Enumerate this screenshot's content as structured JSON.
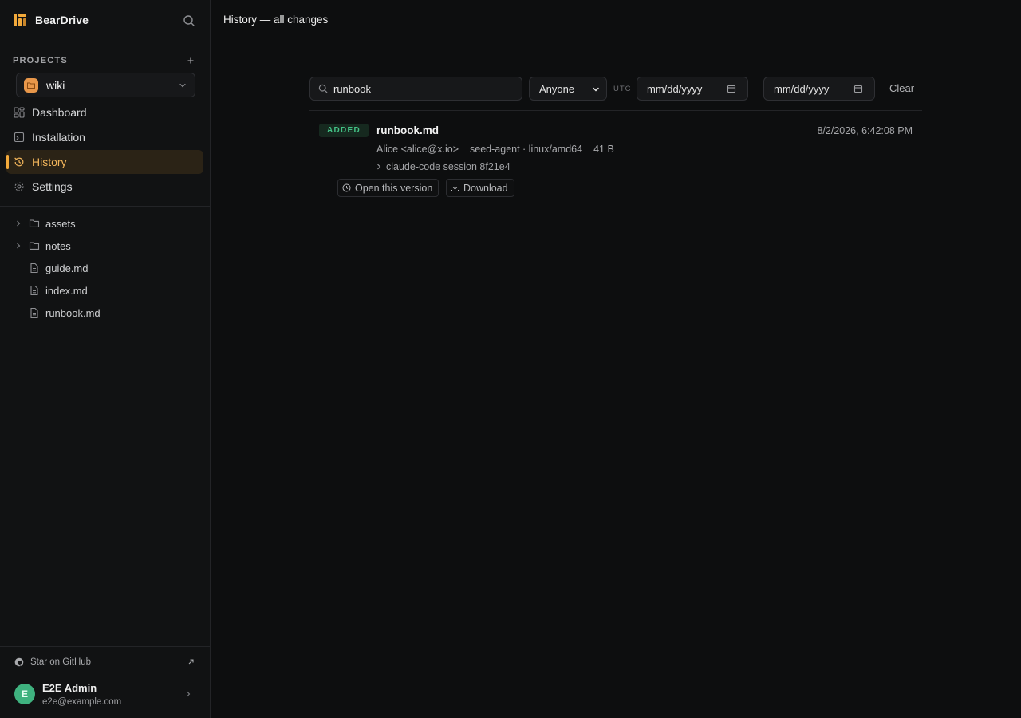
{
  "app": {
    "name": "BearDrive"
  },
  "sidebar": {
    "projects_label": "PROJECTS",
    "project": {
      "name": "wiki",
      "color": "#e8974a"
    },
    "nav": [
      {
        "label": "Dashboard",
        "icon": "dashboard-icon"
      },
      {
        "label": "Installation",
        "icon": "installation-icon"
      },
      {
        "label": "History",
        "icon": "history-icon",
        "active": true
      },
      {
        "label": "Settings",
        "icon": "gear-icon"
      }
    ],
    "tree": [
      {
        "label": "assets",
        "type": "folder"
      },
      {
        "label": "notes",
        "type": "folder"
      },
      {
        "label": "guide.md",
        "type": "file"
      },
      {
        "label": "index.md",
        "type": "file"
      },
      {
        "label": "runbook.md",
        "type": "file"
      }
    ],
    "github": {
      "label": "Star on GitHub"
    },
    "user": {
      "initial": "E",
      "name": "E2E Admin",
      "email": "e2e@example.com",
      "avatar_color": "#3fb27f"
    }
  },
  "header": {
    "title": "History — all changes"
  },
  "filters": {
    "search_value": "runbook",
    "who": "Anyone",
    "utc_label": "UTC",
    "from_placeholder": "mm/dd/yyyy",
    "separator": "–",
    "to_placeholder": "mm/dd/yyyy",
    "clear_label": "Clear"
  },
  "entries": [
    {
      "badge": "ADDED",
      "file": "runbook.md",
      "timestamp": "8/2/2026, 6:42:08 PM",
      "author": "Alice <alice@x.io>",
      "agent": "seed-agent · linux/amd64",
      "size": "41 B",
      "session": "claude-code session 8f21e4",
      "open_label": "Open this version",
      "download_label": "Download"
    }
  ],
  "colors": {
    "accent": "#f2a93b",
    "added": "#43c286",
    "background": "#0d0e0f",
    "sidebar": "#111213"
  }
}
